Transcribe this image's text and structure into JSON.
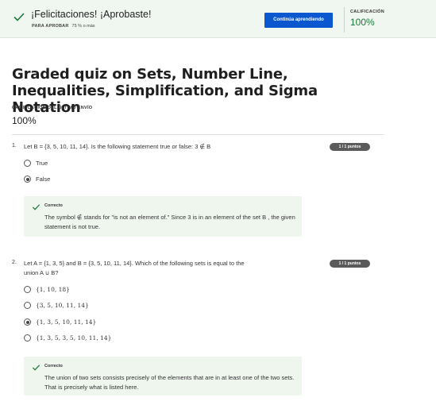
{
  "banner": {
    "title": "¡Felicitaciones! ¡Aprobaste!",
    "pass_label": "PARA APROBAR",
    "pass_value": "75 % o más",
    "continue_label": "Continúa aprendiendo",
    "grade_label": "CALIFICACIÓN",
    "grade_value": "100%"
  },
  "quiz": {
    "title": "Graded quiz on Sets, Number Line, Inequalities, Simplification, and Sigma Notation",
    "last_submission_label": "CALIFICACIÓN DEL ÚLTIMO ENVÍO",
    "last_submission_value": "100%"
  },
  "questions": [
    {
      "number": "1.",
      "text": "Let B = {3, 5, 10, 11, 14}. Is the following statement true or false: 3 ∉ B",
      "points": "1 / 1 puntos",
      "options": [
        {
          "label": "True",
          "selected": false
        },
        {
          "label": "False",
          "selected": true
        }
      ],
      "feedback_label": "Correcto",
      "feedback_text": "The symbol ∉ stands for \"is not an element of.\" Since 3 is in an element of the set B , the given statement is not true."
    },
    {
      "number": "2.",
      "text_line1": "Let A = {1, 3, 5} and B = {3, 5, 10, 11, 14}. Which of the following sets is equal to the",
      "text_line2": "union A ∪ B?",
      "points": "1 / 1 puntos",
      "options": [
        {
          "label": "{1, 10, 18}",
          "selected": false
        },
        {
          "label": "{3, 5, 10, 11, 14}",
          "selected": false
        },
        {
          "label": "{1, 3, 5, 10, 11, 14}",
          "selected": true
        },
        {
          "label": "{1, 3, 5, 3, 5, 10, 11, 14}",
          "selected": false
        }
      ],
      "feedback_label": "Correcto",
      "feedback_text": "The union of two sets consists precisely of the elements that are in at least one of the two sets. That is precisely what is listed here."
    }
  ],
  "colors": {
    "accent": "#0a57d0",
    "success": "#1b7a3a",
    "banner_bg": "#f0f6f0",
    "feedback_bg": "#eef6ee"
  }
}
